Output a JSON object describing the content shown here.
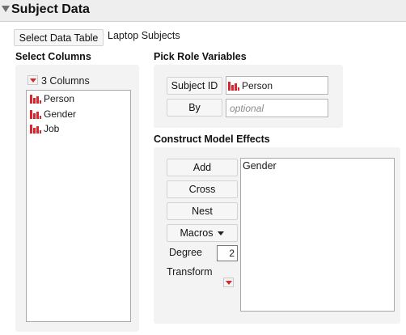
{
  "header": {
    "title": "Subject Data"
  },
  "data_table": {
    "button_label": "Select Data Table",
    "table_name": "Laptop Subjects"
  },
  "select_columns": {
    "title": "Select Columns",
    "count_label": "3 Columns",
    "columns": [
      {
        "name": "Person",
        "icon": "nominal-bar-icon"
      },
      {
        "name": "Gender",
        "icon": "nominal-bar-icon"
      },
      {
        "name": "Job",
        "icon": "nominal-bar-icon"
      }
    ]
  },
  "pick_role": {
    "title": "Pick Role Variables",
    "roles": [
      {
        "label": "Subject ID",
        "value": "Person",
        "placeholder": ""
      },
      {
        "label": "By",
        "value": "",
        "placeholder": "optional"
      }
    ]
  },
  "model_effects": {
    "title": "Construct Model Effects",
    "buttons": {
      "add": "Add",
      "cross": "Cross",
      "nest": "Nest",
      "macros": "Macros"
    },
    "degree_label": "Degree",
    "degree_value": "2",
    "transform_label": "Transform",
    "effects": [
      "Gender"
    ]
  },
  "colors": {
    "accent_red": "#d9262c",
    "header_bg": "#eeeeee"
  }
}
